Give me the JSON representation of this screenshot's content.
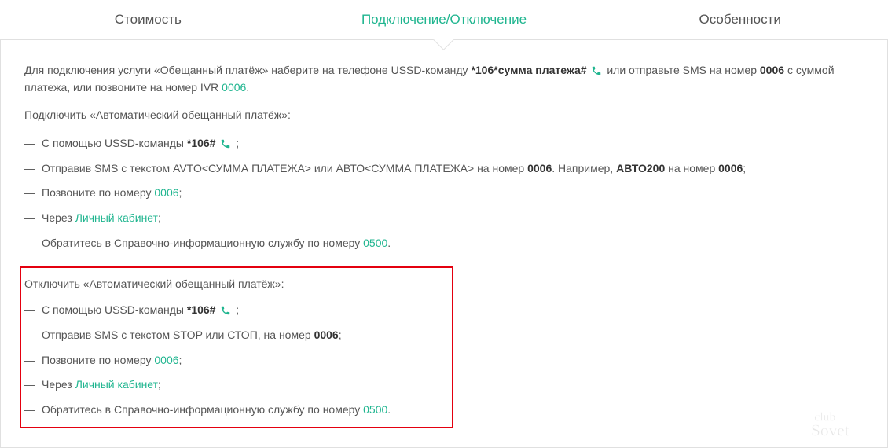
{
  "tabs": {
    "cost": "Стоимость",
    "connect": "Подключение/Отключение",
    "features": "Особенности"
  },
  "intro": {
    "p1a": "Для подключения услуги «Обещанный платёж» наберите на телефоне USSD-команду ",
    "ussd1": "*106*сумма платежа#",
    "p1b": " или отправьте SMS на номер ",
    "sms_num": "0006",
    "p1c": " с суммой платежа, или позвоните на номер IVR ",
    "ivr": "0006",
    "p1d": "."
  },
  "connect_title": "Подключить «Автоматический обещанный платёж»:",
  "connect": {
    "i1a": "С помощью USSD-команды ",
    "i1code": "*106#",
    "i1b": " ;",
    "i2a": "Отправив SMS с текстом AVTO<СУММА ПЛАТЕЖА> или АВТО<СУММА ПЛАТЕЖА> на номер ",
    "i2num": "0006",
    "i2b": ". Например, ",
    "i2ex": "АВТО200",
    "i2c": " на номер ",
    "i2num2": "0006",
    "i2d": ";",
    "i3a": "Позвоните по номеру ",
    "i3link": "0006",
    "i3b": ";",
    "i4a": "Через ",
    "i4link": "Личный кабинет",
    "i4b": ";",
    "i5a": "Обратитесь в Справочно-информационную службу по номеру ",
    "i5link": "0500",
    "i5b": "."
  },
  "disconnect_title": "Отключить «Автоматический обещанный платёж»:",
  "disconnect": {
    "i1a": "С помощью USSD-команды ",
    "i1code": "*106#",
    "i1b": " ;",
    "i2a": "Отправив SMS с текстом STOP или СТОП, на номер ",
    "i2num": "0006",
    "i2b": ";",
    "i3a": "Позвоните по номеру ",
    "i3link": "0006",
    "i3b": ";",
    "i4a": "Через ",
    "i4link": "Личный кабинет",
    "i4b": ";",
    "i5a": "Обратитесь в Справочно-информационную службу по номеру ",
    "i5link": "0500",
    "i5b": "."
  },
  "watermark": "club Sovet"
}
